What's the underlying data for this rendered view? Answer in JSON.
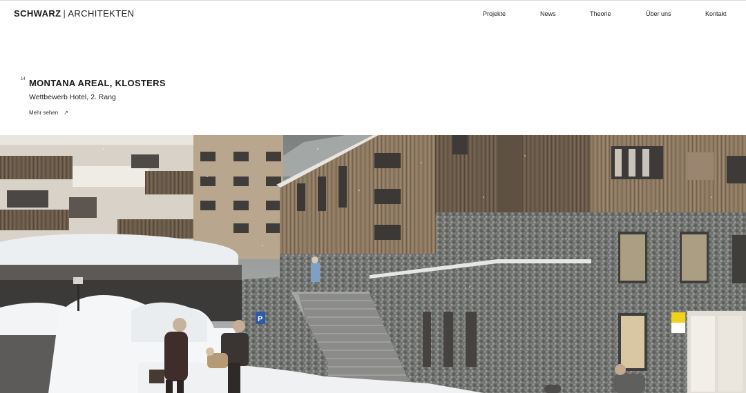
{
  "header": {
    "logo_bold": "SCHWARZ",
    "logo_separator": "|",
    "logo_light": "ARCHITEKTEN"
  },
  "nav": {
    "items": [
      {
        "label": "Projekte"
      },
      {
        "label": "News"
      },
      {
        "label": "Theorie"
      },
      {
        "label": "Über uns"
      },
      {
        "label": "Kontakt"
      }
    ]
  },
  "project": {
    "number": "14",
    "title": "MONTANA AREAL, KLOSTERS",
    "subtitle": "Wettbewerb Hotel, 2. Rang",
    "more_label": "Mehr sehen",
    "more_icon": "arrow-up-right-icon"
  },
  "hero": {
    "description_icon": "hero-image",
    "parking_sign": "P"
  }
}
